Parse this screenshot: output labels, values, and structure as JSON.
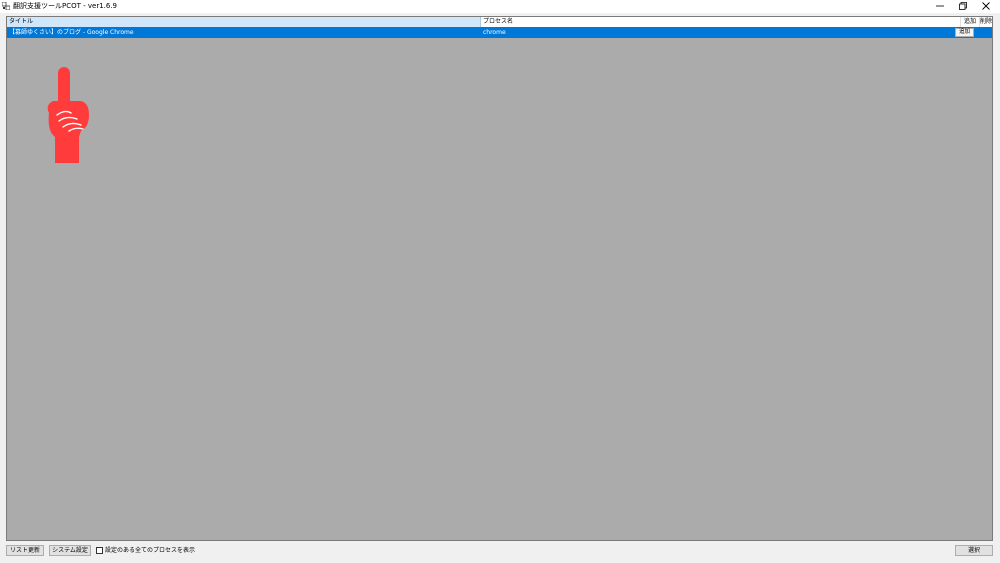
{
  "window": {
    "title": "翻訳支援ツールPCOT - ver1.6.9",
    "icon": "app-window-icon",
    "controls": [
      "minimize-icon",
      "restore-icon",
      "close-icon"
    ]
  },
  "list": {
    "columns": {
      "title": "タイトル",
      "process": "プロセス名",
      "add": "追加",
      "delete": "削除"
    },
    "rows": [
      {
        "title": "【募師ゆくさい】のブログ - Google Chrome",
        "process": "chrome",
        "add_label": "追加",
        "selected": true
      }
    ]
  },
  "overlay": {
    "icon": "pointing-finger-icon",
    "color": "#ff3b3b"
  },
  "footer": {
    "refresh_label": "リスト更新",
    "settings_label": "システム設定",
    "show_all_label": "設定のある全てのプロセスを表示",
    "show_all_checked": false,
    "select_label": "選択"
  },
  "colors": {
    "selection": "#0078d7",
    "list_background": "#ababab",
    "header_highlight": "#cfe6fb"
  }
}
